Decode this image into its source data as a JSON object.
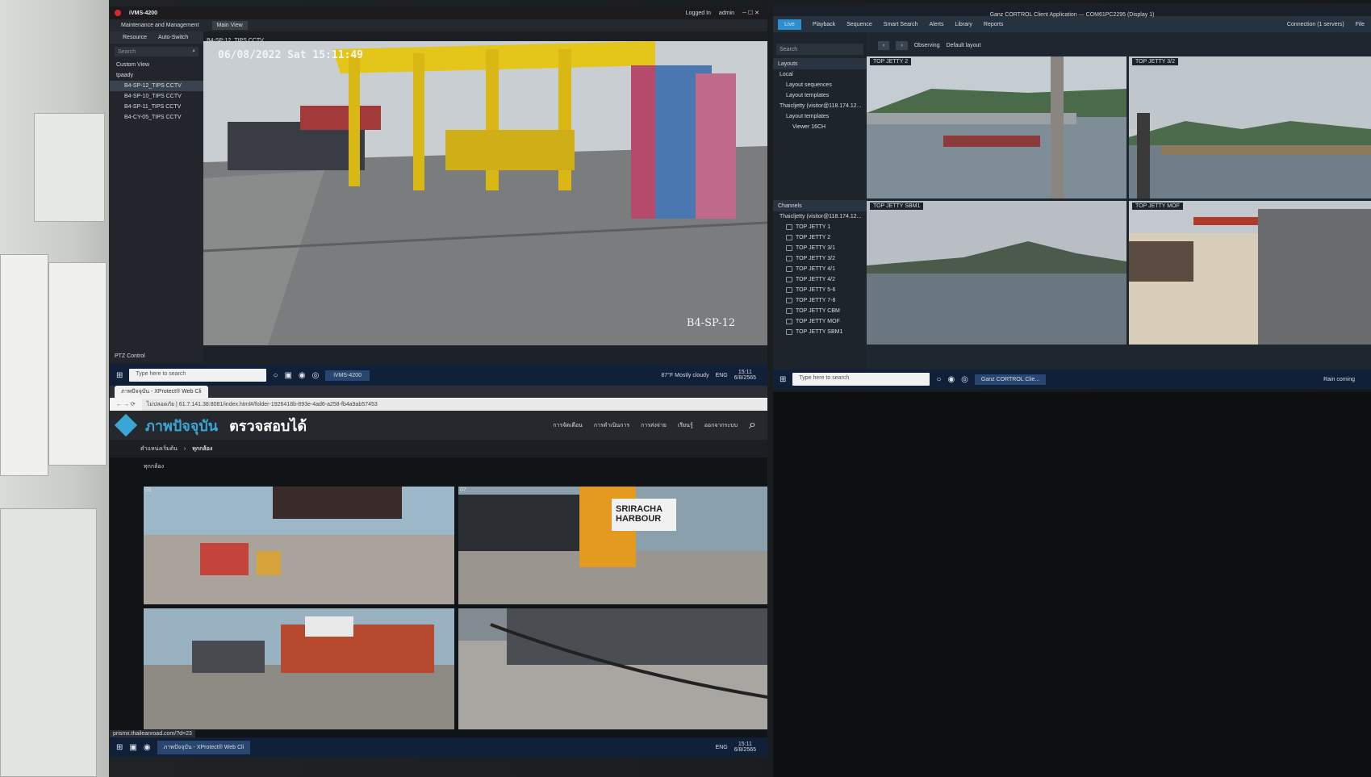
{
  "left_top": {
    "app_title": "iVMS-4200",
    "menu_maint": "Maintenance and Management",
    "menu_main": "Main View",
    "logged": "Logged In",
    "admin": "admin",
    "tab_resource": "Resource",
    "tab_auto": "Auto-Switch",
    "search_placeholder": "Search",
    "tree_custom": "Custom View",
    "tree_group": "tpaady",
    "cameras": [
      "B4-SP-12_TIPS CCTV",
      "B4-SP-10_TIPS CCTV",
      "B4-SP-11_TIPS CCTV",
      "B4-CY-05_TIPS CCTV"
    ],
    "video_title": "B4-SP-12_TIPS CCTV",
    "osd_date": "06/08/2022 Sat 15:11:49",
    "osd_name": "B4-SP-12",
    "ptz": "PTZ Control"
  },
  "taskbar1": {
    "search": "Type here to search",
    "app": "iVMS-4200",
    "weather": "87°F Mostly cloudy",
    "lang": "ENG",
    "time": "15:11",
    "date": "6/8/2565"
  },
  "browser": {
    "tab": "ภาพปัจจุบัน - XProtect® Web Cli",
    "url": "ไม่ปลอดภัย | 61.7.141.38:8081/index.html#/folder-1926418b-893e-4ad6-a258-fb4a9ab57453",
    "brand1": "ภาพปัจจุบัน",
    "brand2": "ตรวจสอบได้",
    "nav": [
      "การจัดเตือน",
      "การดำเนินการ",
      "การส่งจ่าย",
      "เรียนรู้",
      "ออกจากระบบ"
    ],
    "breadcrumb_home": "ตำแหน่งเริ่มต้น",
    "breadcrumb_current": "ทุกกล้อง",
    "section": "ทุกกล้อง",
    "status_url": "prismx.thaileanroad.com/?d=23"
  },
  "taskbar2": {
    "lang": "ENG",
    "time": "15:11",
    "date": "6/8/2565"
  },
  "ganz": {
    "title": "Ganz CORTROL Client Application — COM61PC2295 (Display 1)",
    "toolbar": [
      "Live",
      "Playback",
      "Sequence",
      "Smart Search",
      "Alerts",
      "Library",
      "Reports"
    ],
    "connection": "Connection (1 servers)",
    "file": "File",
    "search": "Search",
    "observing": "Observing",
    "layout": "Default layout",
    "layouts_header": "Layouts",
    "layouts_tree": [
      "Local",
      "Layout sequences",
      "Layout templates",
      "Thaicljetty (visitor@118.174.12...",
      "Layout templates",
      "Viewer 16CH"
    ],
    "channels_header": "Channels",
    "channel_root": "Thaicljetty (visitor@118.174.12...",
    "channels": [
      "TOP JETTY 1",
      "TOP JETTY 2",
      "TOP JETTY 3/1",
      "TOP JETTY 3/2",
      "TOP JETTY 4/1",
      "TOP JETTY 4/2",
      "TOP JETTY 5-6",
      "TOP JETTY 7-8",
      "TOP JETTY CBM",
      "TOP JETTY MOF",
      "TOP JETTY SBM1"
    ],
    "cams": [
      "TOP JETTY 2",
      "TOP JETTY 3/2",
      "TOP JETTY SBM1",
      "TOP JETTY MOF"
    ]
  },
  "taskbar3": {
    "search": "Type here to search",
    "app": "Ganz CORTROL Clie...",
    "weather": "Rain coming"
  },
  "grid_overlay": {
    "sign": "SRIRACHA HARBOUR",
    "counts": [
      "01",
      "07"
    ]
  }
}
